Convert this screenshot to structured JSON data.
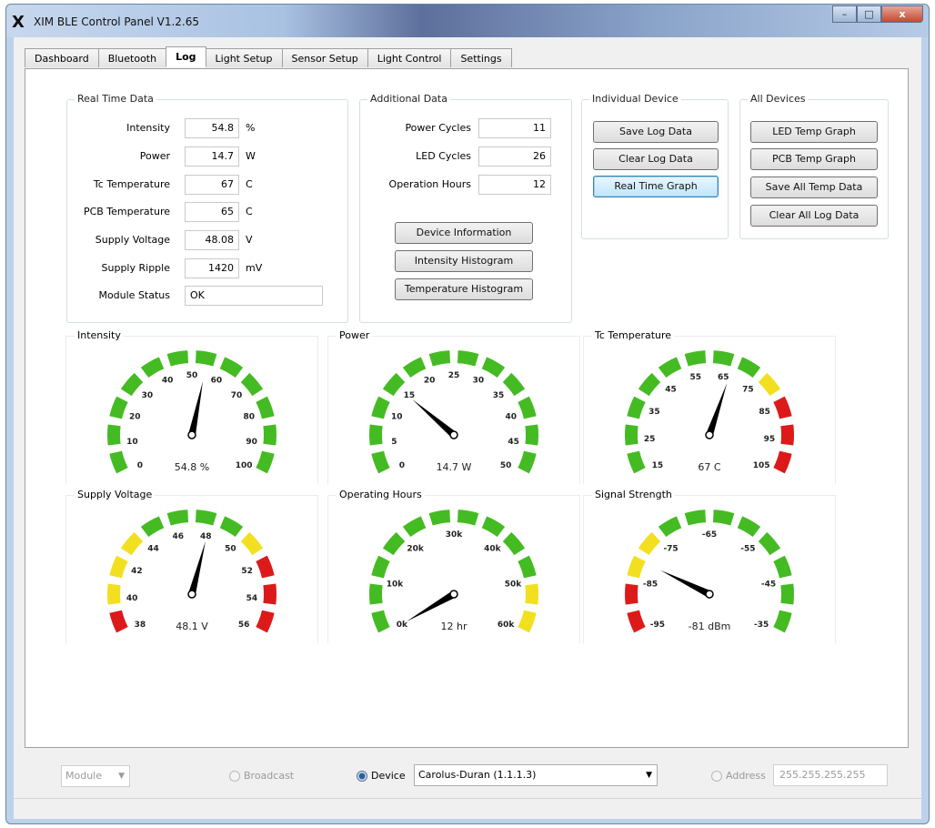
{
  "window": {
    "logo": "X",
    "title": "XIM BLE Control Panel V1.2.65",
    "controls": {
      "minimize": "–",
      "maximize": "□",
      "close": "x"
    }
  },
  "tabs": [
    "Dashboard",
    "Bluetooth",
    "Log",
    "Light Setup",
    "Sensor Setup",
    "Light Control",
    "Settings"
  ],
  "active_tab": "Log",
  "real_time_data": {
    "title": "Real Time Data",
    "rows": [
      {
        "label": "Intensity",
        "value": "54.8",
        "unit": "%"
      },
      {
        "label": "Power",
        "value": "14.7",
        "unit": "W"
      },
      {
        "label": "Tc Temperature",
        "value": "67",
        "unit": "C"
      },
      {
        "label": "PCB Temperature",
        "value": "65",
        "unit": "C"
      },
      {
        "label": "Supply Voltage",
        "value": "48.08",
        "unit": "V"
      },
      {
        "label": "Supply Ripple",
        "value": "1420",
        "unit": "mV"
      }
    ],
    "status_label": "Module Status",
    "status_value": "OK"
  },
  "additional_data": {
    "title": "Additional Data",
    "rows": [
      {
        "label": "Power Cycles",
        "value": "11"
      },
      {
        "label": "LED Cycles",
        "value": "26"
      },
      {
        "label": "Operation Hours",
        "value": "12"
      }
    ],
    "buttons": [
      "Device Information",
      "Intensity Histogram",
      "Temperature Histogram"
    ]
  },
  "individual_device": {
    "title": "Individual Device",
    "buttons": [
      "Save Log Data",
      "Clear Log Data",
      "Real Time Graph"
    ]
  },
  "all_devices": {
    "title": "All Devices",
    "buttons": [
      "LED Temp Graph",
      "PCB Temp Graph",
      "Save All Temp Data",
      "Clear All Log Data"
    ]
  },
  "colors": {
    "green": "#44bb22",
    "yellow": "#f2e020",
    "red": "#dd1a1a",
    "needle": "#000000"
  },
  "gauges": [
    {
      "title": "Intensity",
      "readout": "54.8 %",
      "min": 0,
      "max": 100,
      "value": 54.8,
      "ticks": [
        "0",
        "10",
        "20",
        "30",
        "40",
        "50",
        "60",
        "70",
        "80",
        "90",
        "100"
      ],
      "zones": [
        {
          "to": 1.0,
          "color": "green"
        }
      ]
    },
    {
      "title": "Power",
      "readout": "14.7 W",
      "min": 0,
      "max": 50,
      "value": 14.7,
      "ticks": [
        "0",
        "5",
        "10",
        "15",
        "20",
        "25",
        "30",
        "35",
        "40",
        "45",
        "50"
      ],
      "zones": [
        {
          "to": 1.0,
          "color": "green"
        }
      ]
    },
    {
      "title": "Tc Temperature",
      "readout": "67 C",
      "min": 15,
      "max": 105,
      "value": 67,
      "ticks": [
        "15",
        "25",
        "35",
        "45",
        "55",
        "65",
        "75",
        "85",
        "95",
        "105"
      ],
      "zones": [
        {
          "to": 0.667,
          "color": "green"
        },
        {
          "to": 0.778,
          "color": "yellow"
        },
        {
          "to": 1.0,
          "color": "red"
        }
      ]
    },
    {
      "title": "Supply Voltage",
      "readout": "48.1 V",
      "min": 38,
      "max": 56,
      "value": 48.08,
      "ticks": [
        "38",
        "40",
        "42",
        "44",
        "46",
        "48",
        "50",
        "52",
        "54",
        "56"
      ],
      "zones": [
        {
          "to": 0.111,
          "color": "red"
        },
        {
          "to": 0.333,
          "color": "yellow"
        },
        {
          "to": 0.667,
          "color": "green"
        },
        {
          "to": 0.778,
          "color": "yellow"
        },
        {
          "to": 1.0,
          "color": "red"
        }
      ]
    },
    {
      "title": "Operating Hours",
      "readout": "12 hr",
      "min": 0,
      "max": 60000,
      "value": 12,
      "ticks": [
        "0k",
        "10k",
        "20k",
        "30k",
        "40k",
        "50k",
        "60k"
      ],
      "zones": [
        {
          "to": 0.833,
          "color": "green"
        },
        {
          "to": 1.0,
          "color": "yellow"
        }
      ]
    },
    {
      "title": "Signal Strength",
      "readout": "-81 dBm",
      "min": -95,
      "max": -35,
      "value": -81,
      "ticks": [
        "-95",
        "-85",
        "-75",
        "-65",
        "-55",
        "-45",
        "-35"
      ],
      "zones": [
        {
          "to": 0.167,
          "color": "red"
        },
        {
          "to": 0.333,
          "color": "yellow"
        },
        {
          "to": 1.0,
          "color": "green"
        }
      ]
    }
  ],
  "bottom": {
    "module_combo": "Module",
    "broadcast_label": "Broadcast",
    "device_label": "Device",
    "device_value": "Carolus-Duran (1.1.1.3)",
    "address_label": "Address",
    "address_value": "255.255.255.255",
    "selected": "Device"
  }
}
